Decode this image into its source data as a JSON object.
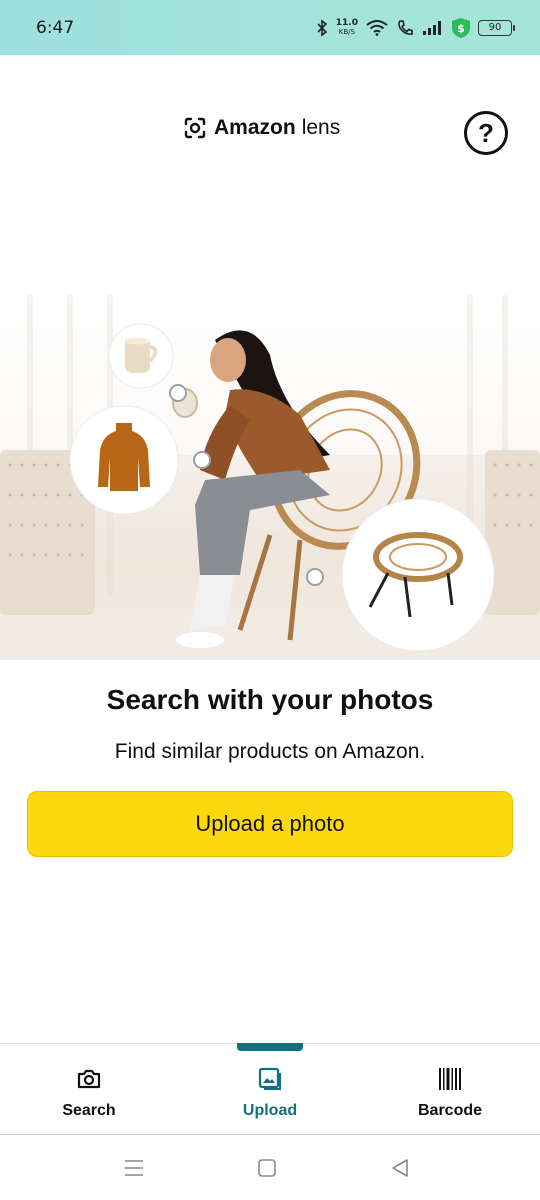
{
  "status_bar": {
    "time": "6:47",
    "net_speed_value": "11.0",
    "net_speed_unit": "KB/S",
    "battery": "90"
  },
  "header": {
    "brand": "Amazon",
    "product": "lens",
    "help_symbol": "?"
  },
  "hero": {
    "icons": [
      "mug-icon",
      "sweater-icon",
      "chair-icon"
    ]
  },
  "main": {
    "headline": "Search with your photos",
    "subline": "Find similar products on Amazon.",
    "upload_button": "Upload a photo"
  },
  "tabs": [
    {
      "label": "Search",
      "icon": "camera-icon",
      "active": false
    },
    {
      "label": "Upload",
      "icon": "image-icon",
      "active": true
    },
    {
      "label": "Barcode",
      "icon": "barcode-icon",
      "active": false
    }
  ],
  "colors": {
    "accent": "#11707e",
    "button": "#fdd80f",
    "status_bar": "#9ee0e0"
  }
}
